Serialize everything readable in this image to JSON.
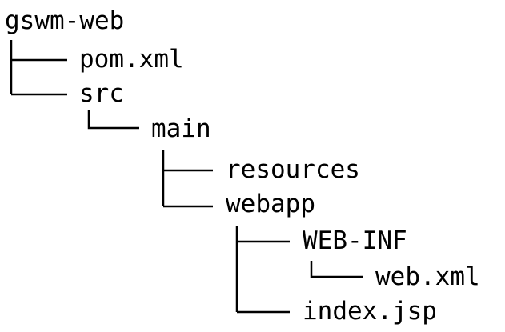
{
  "tree": {
    "root": "gswm-web",
    "nodes": {
      "pom_xml": "pom.xml",
      "src": "src",
      "main": "main",
      "resources": "resources",
      "webapp": "webapp",
      "web_inf": "WEB-INF",
      "web_xml": "web.xml",
      "index_jsp": "index.jsp"
    }
  }
}
